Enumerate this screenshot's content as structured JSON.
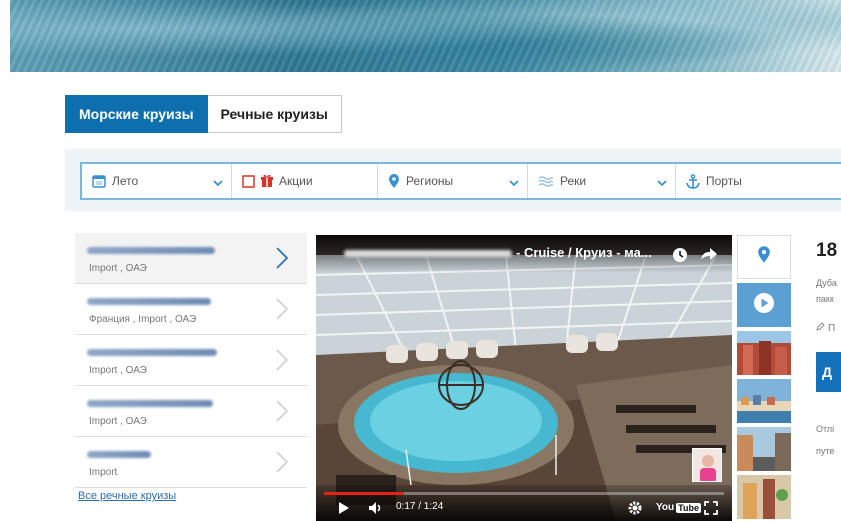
{
  "tabs": [
    {
      "label": "Морские круизы",
      "active": true
    },
    {
      "label": "Речные круизы",
      "active": false
    }
  ],
  "filters": [
    {
      "label": "Лето",
      "icon": "calendar-icon"
    },
    {
      "label": "Акции",
      "icon": "gift-icon"
    },
    {
      "label": "Регионы",
      "icon": "map-pin-icon"
    },
    {
      "label": "Реки",
      "icon": "waves-icon"
    },
    {
      "label": "Порты",
      "icon": "anchor-icon"
    }
  ],
  "cruise_list": [
    {
      "subtitle": "Import , ОАЭ"
    },
    {
      "subtitle": "Франция , Import , ОАЭ"
    },
    {
      "subtitle": "Import , ОАЭ"
    },
    {
      "subtitle": "Import , ОАЭ"
    },
    {
      "subtitle": "Import"
    }
  ],
  "all_link": "Все речные круизы",
  "video": {
    "title": "- Cruise / Круиз - ма...",
    "time": "0:17 / 1:24",
    "progress": 0.2,
    "brand": "You",
    "brand_tube": "Tube"
  },
  "right_panel": {
    "number": "18",
    "line1": "Дуба",
    "line2": "пакк",
    "line3": "П",
    "button": "Д",
    "text1": "Отлі",
    "text2": "путе"
  },
  "colors": {
    "accent": "#0e6fae",
    "filter_border": "#7ab7dd",
    "icon_blue": "#3b8fd0",
    "gift_red": "#d9342b"
  }
}
